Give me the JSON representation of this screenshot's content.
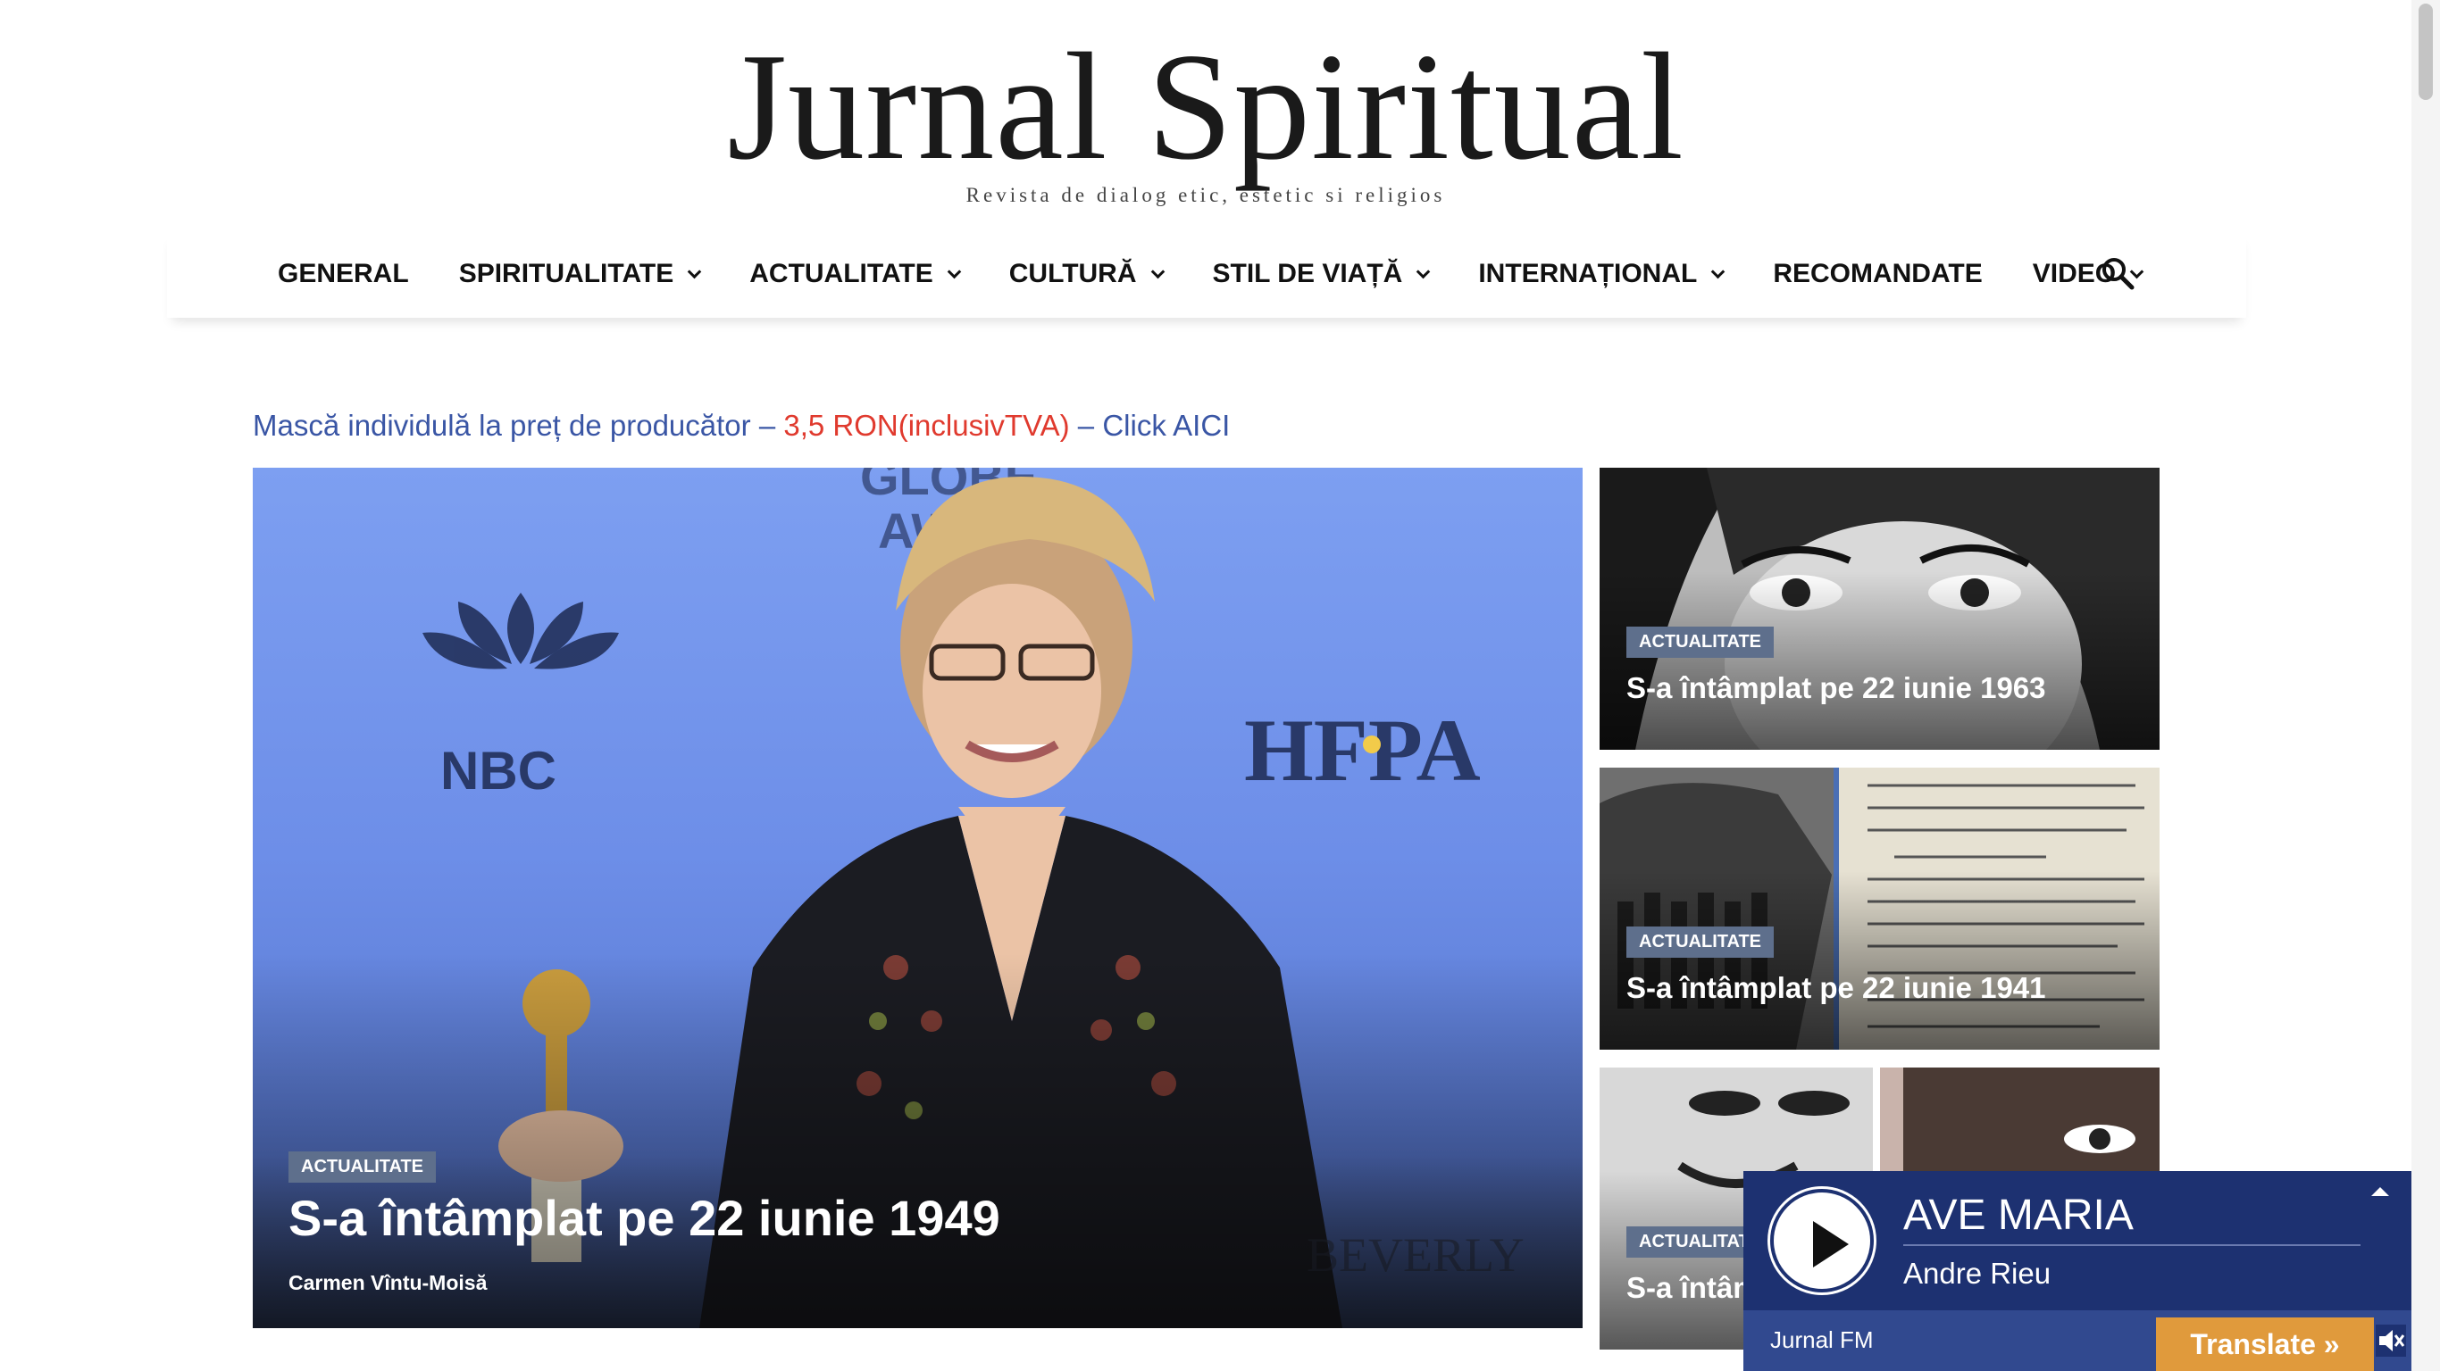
{
  "site": {
    "title": "Jurnal Spiritual",
    "tagline": "Revista de dialog etic, estetic si religios"
  },
  "nav": {
    "items": [
      {
        "label": "GENERAL",
        "has_dropdown": false
      },
      {
        "label": "SPIRITUALITATE",
        "has_dropdown": true
      },
      {
        "label": "ACTUALITATE",
        "has_dropdown": true
      },
      {
        "label": "CULTURĂ",
        "has_dropdown": true
      },
      {
        "label": "STIL DE VIAȚĂ",
        "has_dropdown": true
      },
      {
        "label": "INTERNAȚIONAL",
        "has_dropdown": true
      },
      {
        "label": "RECOMANDATE",
        "has_dropdown": false
      },
      {
        "label": "VIDEO",
        "has_dropdown": true
      }
    ],
    "search_icon": "search-icon"
  },
  "promo": {
    "part1": "Mască individulă la preț de producător – ",
    "part2": "3,5 RON(inclusivTVA)",
    "part3": " – Click AICI",
    "color_main": "#3a56a5",
    "color_highlight": "#e03a2e"
  },
  "feature": {
    "category": "ACTUALITATE",
    "title": "S-a întâmplat pe 22 iunie 1949",
    "author": "Carmen Vîntu-Moisă"
  },
  "side_posts": [
    {
      "category": "ACTUALITATE",
      "title": "S-a întâmplat pe 22 iunie 1963"
    },
    {
      "category": "ACTUALITATE",
      "title": "S-a întâmplat pe 22 iunie 1941"
    },
    {
      "category": "ACTUALITATE",
      "title": "S-a întâm"
    }
  ],
  "player": {
    "song": "AVE MARIA",
    "artist": "Andre Rieu",
    "station": "Jurnal FM",
    "play_icon": "play-icon",
    "collapse_icon": "chevron-up-icon"
  },
  "translate": {
    "label": "Translate »"
  },
  "volume_icon": "volume-mute-icon",
  "colors": {
    "player_bg": "#1d3171",
    "player_bar": "#31498f",
    "translate_bg": "#e09a3c",
    "badge_bg": "#5e6f8c"
  }
}
